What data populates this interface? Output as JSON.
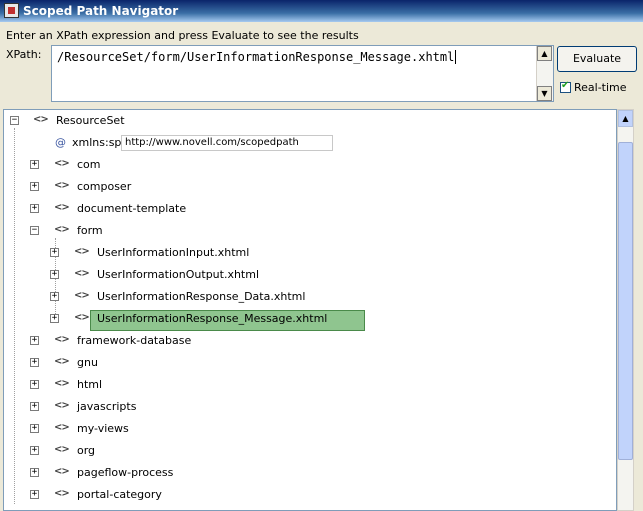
{
  "window": {
    "title": "Scoped Path Navigator"
  },
  "instructions": "Enter an XPath expression and press Evaluate to see the results",
  "xpath": {
    "label": "XPath:",
    "value": "/ResourceSet/form/UserInformationResponse_Message.xhtml"
  },
  "buttons": {
    "evaluate": "Evaluate",
    "realtime": "Real-time"
  },
  "tree": {
    "root": "ResourceSet",
    "attribute": {
      "name": "xmlns:sp",
      "value": "http://www.novell.com/scopedpath"
    },
    "nodes": [
      "com",
      "composer",
      "document-template",
      "form"
    ],
    "form_children": [
      "UserInformationInput.xhtml",
      "UserInformationOutput.xhtml",
      "UserInformationResponse_Data.xhtml",
      "UserInformationResponse_Message.xhtml"
    ],
    "after_nodes": [
      "framework-database",
      "gnu",
      "html",
      "javascripts",
      "my-views",
      "org",
      "pageflow-process",
      "portal-category"
    ]
  }
}
